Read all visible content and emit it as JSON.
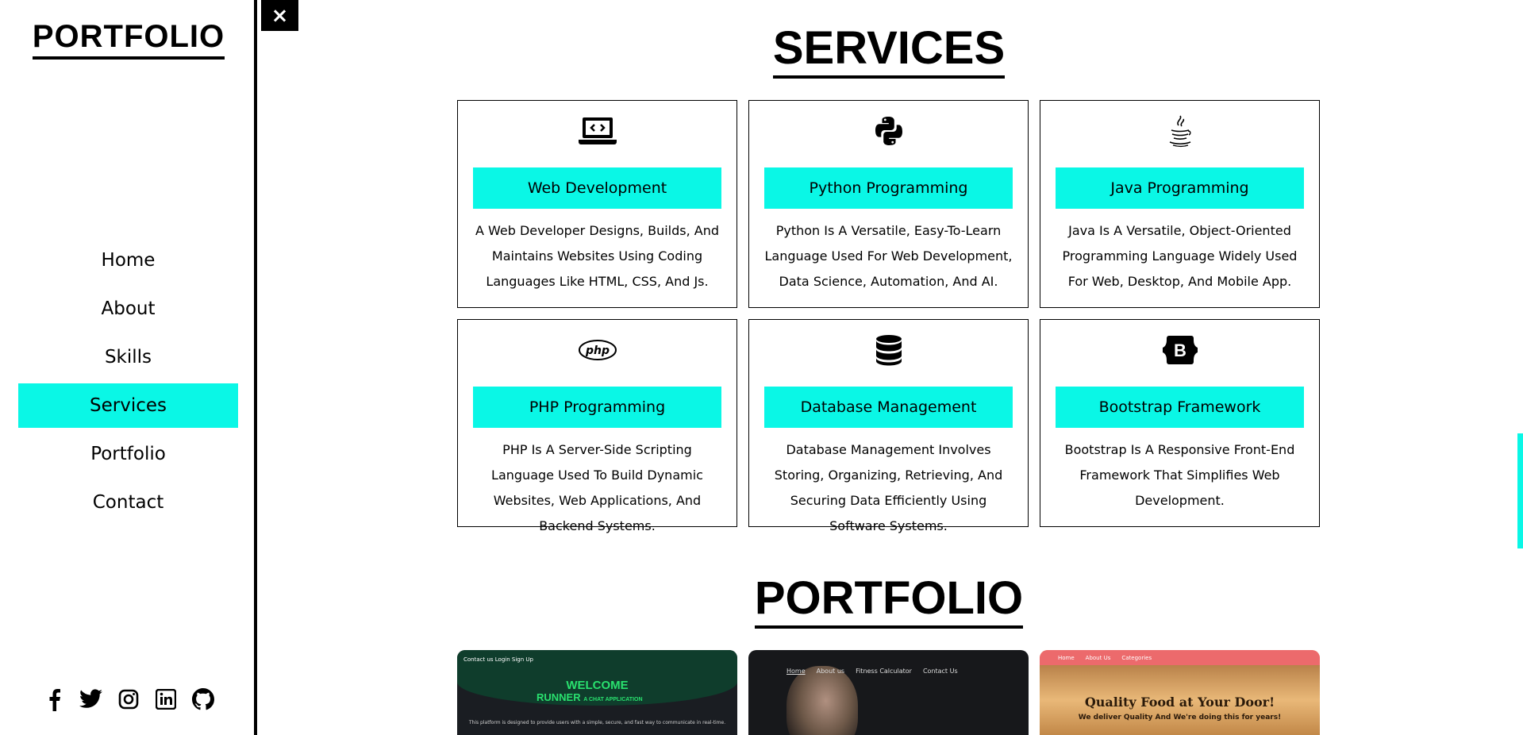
{
  "sidebar": {
    "logo": "PORTFOLIO",
    "nav": [
      {
        "label": "Home",
        "active": false
      },
      {
        "label": "About",
        "active": false
      },
      {
        "label": "Skills",
        "active": false
      },
      {
        "label": "Services",
        "active": true
      },
      {
        "label": "Portfolio",
        "active": false
      },
      {
        "label": "Contact",
        "active": false
      }
    ],
    "social": [
      "facebook-icon",
      "twitter-icon",
      "instagram-icon",
      "linkedin-icon",
      "github-icon"
    ]
  },
  "close_button": "×",
  "services": {
    "title": "SERVICES",
    "items": [
      {
        "icon": "laptop-code-icon",
        "label": "Web Development",
        "desc": "A Web Developer Designs, Builds, And Maintains Websites Using Coding Languages Like HTML, CSS, And Js."
      },
      {
        "icon": "python-icon",
        "label": "Python Programming",
        "desc": "Python Is A Versatile, Easy-To-Learn Language Used For Web Development, Data Science, Automation, And AI."
      },
      {
        "icon": "java-icon",
        "label": "Java Programming",
        "desc": "Java Is A Versatile, Object-Oriented Programming Language Widely Used For Web, Desktop, And Mobile App."
      },
      {
        "icon": "php-icon",
        "label": "PHP Programming",
        "desc": "PHP Is A Server-Side Scripting Language Used To Build Dynamic Websites, Web Applications, And Backend Systems."
      },
      {
        "icon": "database-icon",
        "label": "Database Management",
        "desc": "Database Management Involves Storing, Organizing, Retrieving, And Securing Data Efficiently Using Software Systems."
      },
      {
        "icon": "bootstrap-icon",
        "label": "Bootstrap Framework",
        "desc": "Bootstrap Is A Responsive Front-End Framework That Simplifies Web Development."
      }
    ]
  },
  "portfolio": {
    "title": "PORTFOLIO",
    "projects": [
      {
        "nav": "Contact us   Login   Sign Up",
        "heading": "WELCOME",
        "subheading": "RUNNER",
        "tagline": "A CHAT APPLICATION",
        "body": "This platform is designed to provide users with a simple, secure, and fast way to communicate in real-time."
      },
      {
        "nav": [
          "Home",
          "About us",
          "Fitness Calculator",
          "Contact Us"
        ]
      },
      {
        "nav": [
          "Home",
          "About Us",
          "Categories"
        ],
        "heading": "Quality Food at Your Door!",
        "subheading": "We deliver Quality And We're doing this for years!"
      }
    ]
  },
  "colors": {
    "accent": "#0af7e6",
    "border": "#000000"
  }
}
